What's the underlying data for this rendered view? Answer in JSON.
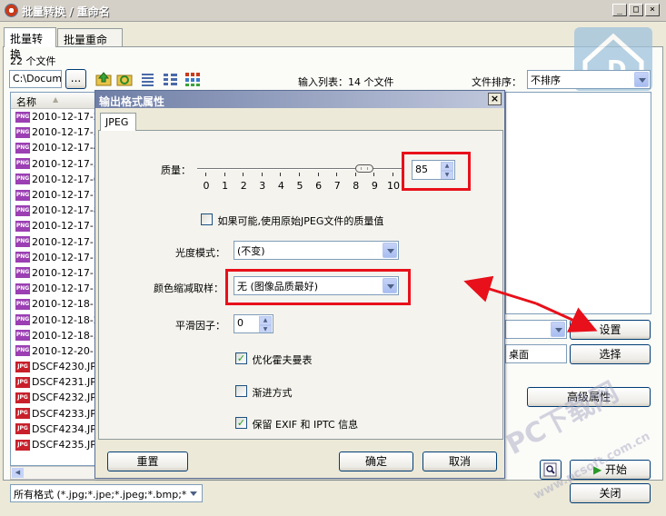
{
  "window": {
    "title": "批量转换 / 重命名"
  },
  "tabs": [
    "批量转换",
    "批量重命名"
  ],
  "main": {
    "file_count": "22 个文件",
    "path": "C:\\Docume",
    "browse_label": "...",
    "input_list_label": "输入列表：14 个文件",
    "sort_label": "文件排序：",
    "sort_value": "不排序",
    "column_name": "名称",
    "files": [
      {
        "name": "2010-12-17-2.",
        "type": "PNG"
      },
      {
        "name": "2010-12-17-3.",
        "type": "PNG"
      },
      {
        "name": "2010-12-17-4.",
        "type": "PNG"
      },
      {
        "name": "2010-12-17-5.",
        "type": "PNG"
      },
      {
        "name": "2010-12-17-6.",
        "type": "PNG"
      },
      {
        "name": "2010-12-17-7.",
        "type": "PNG"
      },
      {
        "name": "2010-12-17-8.",
        "type": "PNG"
      },
      {
        "name": "2010-12-17-10",
        "type": "PNG"
      },
      {
        "name": "2010-12-17-11",
        "type": "PNG"
      },
      {
        "name": "2010-12-17-12",
        "type": "PNG"
      },
      {
        "name": "2010-12-17-13",
        "type": "PNG"
      },
      {
        "name": "2010-12-17-14",
        "type": "PNG"
      },
      {
        "name": "2010-12-18-1.",
        "type": "PNG"
      },
      {
        "name": "2010-12-18-2.",
        "type": "PNG"
      },
      {
        "name": "2010-12-18-3.",
        "type": "PNG"
      },
      {
        "name": "2010-12-20-1.",
        "type": "PNG"
      },
      {
        "name": "DSCF4230.JPG",
        "type": "JPG"
      },
      {
        "name": "DSCF4231.JPG",
        "type": "JPG"
      },
      {
        "name": "DSCF4232.JPG",
        "type": "JPG"
      },
      {
        "name": "DSCF4233.JPG",
        "type": "JPG"
      },
      {
        "name": "DSCF4234.JPG",
        "type": "JPG"
      },
      {
        "name": "DSCF4235.JPG",
        "type": "JPG"
      }
    ],
    "filter_value": "所有格式 (*.jpg;*.jpe;*.jpeg;*.bmp;*.",
    "dest_value": "桌面",
    "settings_label": "设置",
    "choose_label": "选择",
    "advanced_label": "高级属性",
    "start_label": "开始",
    "close_label": "关闭"
  },
  "dialog": {
    "title": "输出格式属性",
    "tab": "JPEG",
    "quality_label": "质量：",
    "quality_value": "85",
    "quality_level": 0.85,
    "slider_ticks": [
      "0",
      "1",
      "2",
      "3",
      "4",
      "5",
      "6",
      "7",
      "8",
      "9",
      "10"
    ],
    "keep_quality_label": "如果可能,使用原始JPEG文件的质量值",
    "keep_quality_checked": false,
    "luminance_label": "光度模式：",
    "luminance_value": "(不变)",
    "subsample_label": "颜色缩减取样：",
    "subsample_value": "无 (图像品质最好)",
    "smoothing_label": "平滑因子：",
    "smoothing_value": "0",
    "optimize_label": "优化霍夫曼表",
    "optimize_checked": true,
    "progressive_label": "渐进方式",
    "progressive_checked": false,
    "keep_exif_label": "保留 EXIF 和 IPTC 信息",
    "keep_exif_checked": true,
    "reset_label": "重置",
    "ok_label": "确定",
    "cancel_label": "取消"
  },
  "colors": {
    "highlight": "#e8101a",
    "titlebar": "#6f7ea6"
  },
  "watermark": {
    "text": "PC下载网",
    "url": "www.pcsoft.com.cn"
  }
}
